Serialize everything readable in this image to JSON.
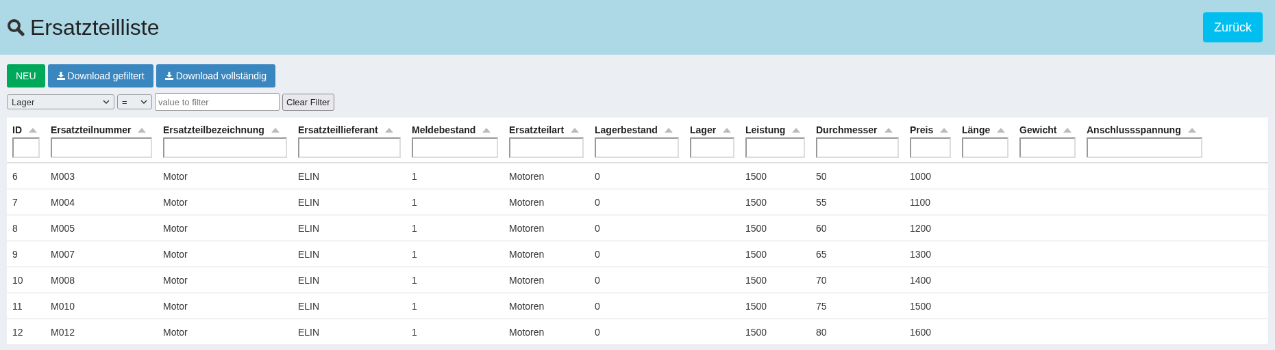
{
  "header": {
    "title": "Ersatzteilliste",
    "back_button": "Zurück"
  },
  "toolbar": {
    "new_button": "NEU",
    "download_buttons": [
      "Download gefiltert",
      "Download vollständig"
    ]
  },
  "filter": {
    "field": "Lager",
    "operator": "=",
    "placeholder": "value to filter",
    "clear_button": "Clear Filter"
  },
  "table": {
    "columns": [
      "ID",
      "Ersatzteilnummer",
      "Ersatzteilbezeichnung",
      "Ersatzteillieferant",
      "Meldebestand",
      "Ersatzteilart",
      "Lagerbestand",
      "Lager",
      "Leistung",
      "Durchmesser",
      "Preis",
      "Länge",
      "Gewicht",
      "Anschlussspannung"
    ],
    "rows": [
      [
        "6",
        "M003",
        "Motor",
        "ELIN",
        "1",
        "Motoren",
        "0",
        null,
        "1500",
        "50",
        "1000",
        null,
        null,
        null
      ],
      [
        "7",
        "M004",
        "Motor",
        "ELIN",
        "1",
        "Motoren",
        "0",
        null,
        "1500",
        "55",
        "1100",
        null,
        null,
        null
      ],
      [
        "8",
        "M005",
        "Motor",
        "ELIN",
        "1",
        "Motoren",
        "0",
        null,
        "1500",
        "60",
        "1200",
        null,
        null,
        null
      ],
      [
        "9",
        "M007",
        "Motor",
        "ELIN",
        "1",
        "Motoren",
        "0",
        null,
        "1500",
        "65",
        "1300",
        null,
        null,
        null
      ],
      [
        "10",
        "M008",
        "Motor",
        "ELIN",
        "1",
        "Motoren",
        "0",
        null,
        "1500",
        "70",
        "1400",
        null,
        null,
        null
      ],
      [
        "11",
        "M010",
        "Motor",
        "ELIN",
        "1",
        "Motoren",
        "0",
        null,
        "1500",
        "75",
        "1500",
        null,
        null,
        null
      ],
      [
        "12",
        "M012",
        "Motor",
        "ELIN",
        "1",
        "Motoren",
        "0",
        null,
        "1500",
        "80",
        "1600",
        null,
        null,
        null
      ]
    ]
  }
}
